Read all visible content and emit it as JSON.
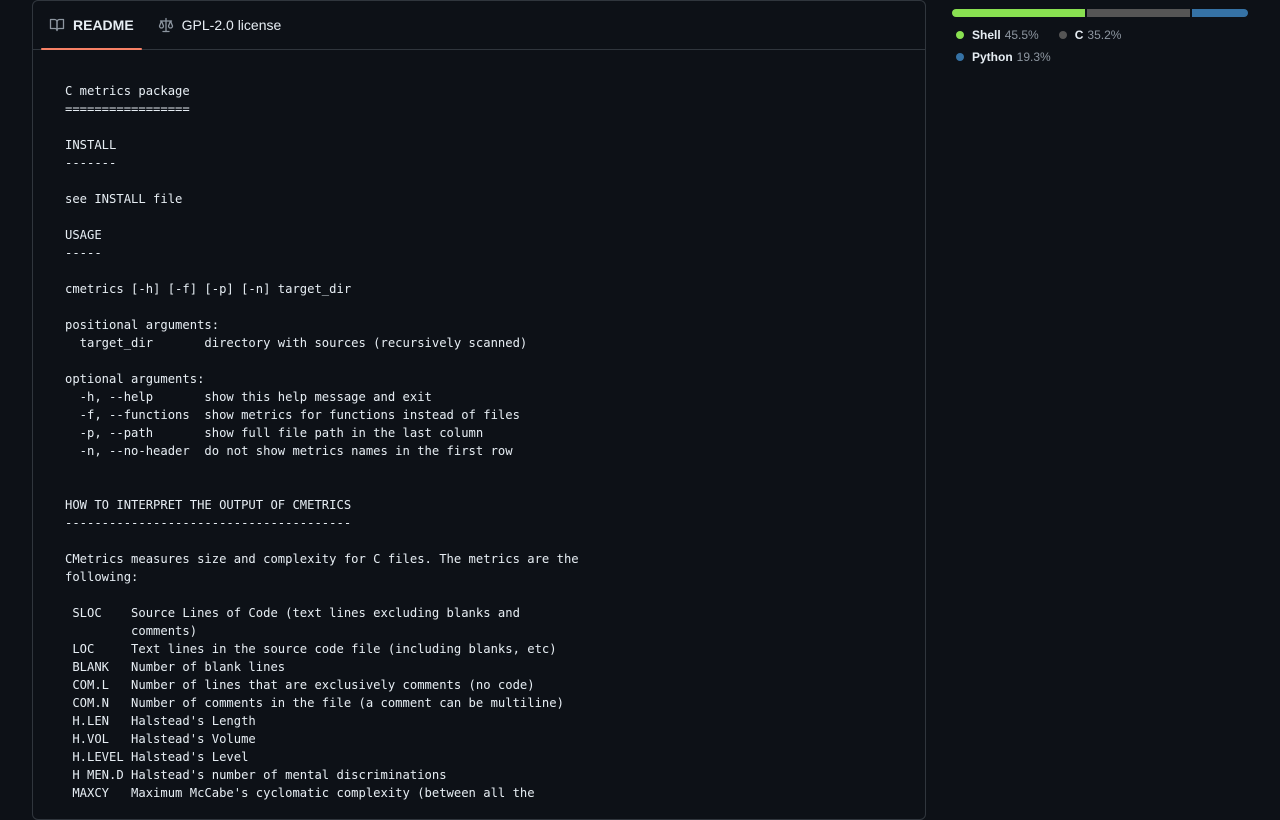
{
  "readme": {
    "tabs": [
      {
        "label": "README",
        "icon": "book-icon",
        "active": true
      },
      {
        "label": "GPL-2.0 license",
        "icon": "law-scale-icon",
        "active": false
      }
    ],
    "content": "C metrics package\n=================\n\nINSTALL\n-------\n\nsee INSTALL file\n\nUSAGE\n-----\n\ncmetrics [-h] [-f] [-p] [-n] target_dir\n\npositional arguments:\n  target_dir       directory with sources (recursively scanned)\n\noptional arguments:\n  -h, --help       show this help message and exit\n  -f, --functions  show metrics for functions instead of files\n  -p, --path       show full file path in the last column\n  -n, --no-header  do not show metrics names in the first row\n\n\nHOW TO INTERPRET THE OUTPUT OF CMETRICS\n---------------------------------------\n\nCMetrics measures size and complexity for C files. The metrics are the\nfollowing:\n\n SLOC    Source Lines of Code (text lines excluding blanks and\n         comments)\n LOC     Text lines in the source code file (including blanks, etc)\n BLANK   Number of blank lines\n COM.L   Number of lines that are exclusively comments (no code)\n COM.N   Number of comments in the file (a comment can be multiline)\n H.LEN   Halstead's Length\n H.VOL   Halstead's Volume\n H.LEVEL Halstead's Level\n H MEN.D Halstead's number of mental discriminations\n MAXCY   Maximum McCabe's cyclomatic complexity (between all the"
  },
  "languages": [
    {
      "name": "Shell",
      "percent": "45.5%",
      "share": 45.5,
      "color": "#89e051"
    },
    {
      "name": "C",
      "percent": "35.2%",
      "share": 35.2,
      "color": "#555555"
    },
    {
      "name": "Python",
      "percent": "19.3%",
      "share": 19.3,
      "color": "#3572a5"
    }
  ],
  "colors": {
    "background": "#0d1117",
    "border": "#30363d",
    "active_tab_underline": "#f78166",
    "text": "#e6edf3",
    "muted_text": "#8d96a0"
  }
}
